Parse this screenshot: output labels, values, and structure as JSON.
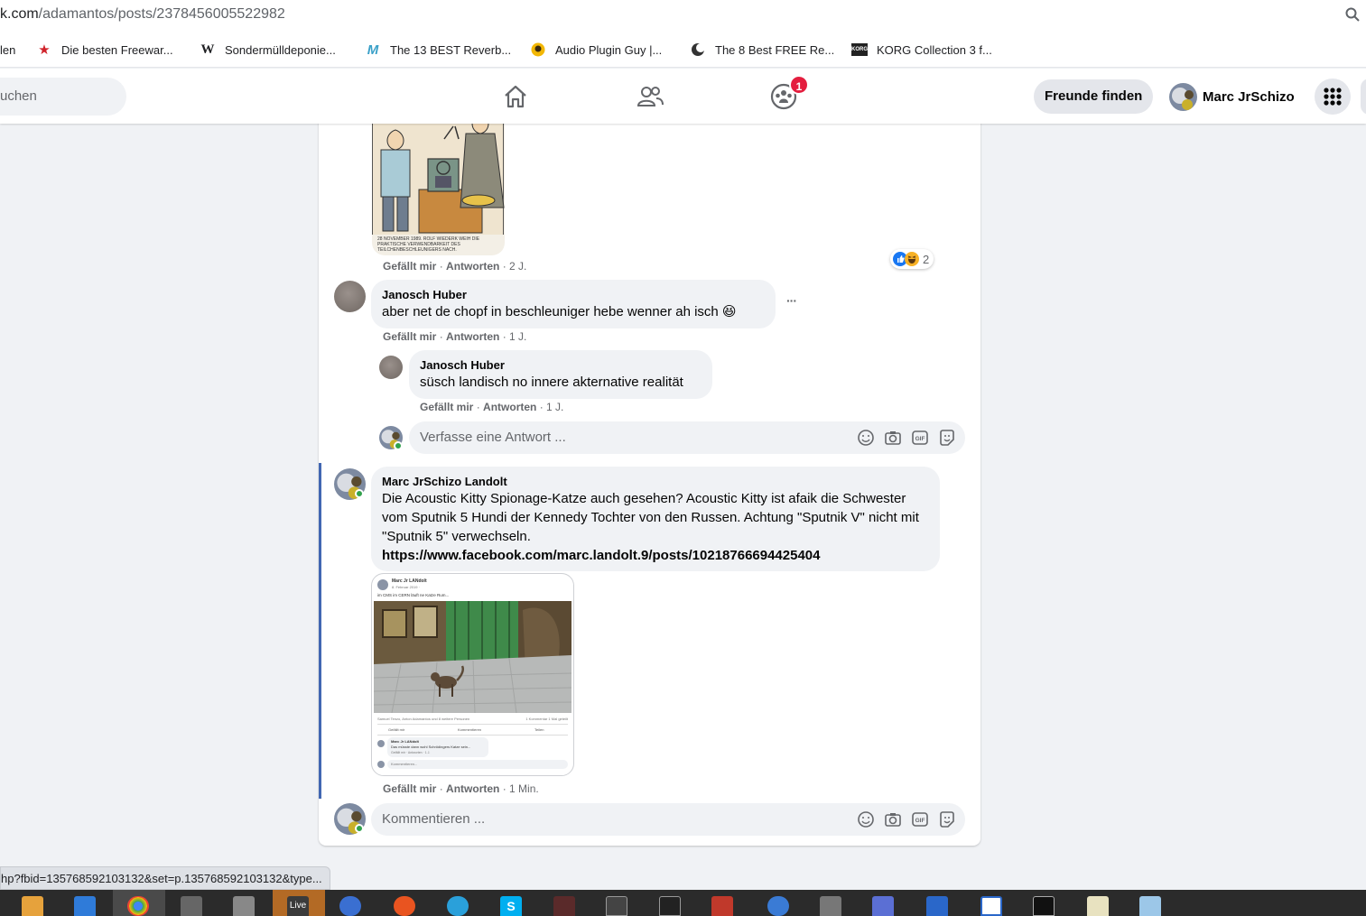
{
  "browser": {
    "url_prefix": "k.com",
    "url_path": "/adamantos/posts/2378456005522982",
    "status_url": "hp?fbid=135768592103132&set=p.135768592103132&type..."
  },
  "bookmarks": [
    {
      "label": "len",
      "icon": "folder-icon"
    },
    {
      "label": "Die besten Freewar...",
      "icon": "star-icon"
    },
    {
      "label": "Sondermülldeponie...",
      "icon": "wikipedia-icon",
      "glyph": "W"
    },
    {
      "label": "The 13 BEST Reverb...",
      "icon": "musician-icon"
    },
    {
      "label": "Audio Plugin Guy |...",
      "icon": "plugin-guy-icon"
    },
    {
      "label": "The 8 Best FREE Re...",
      "icon": "moon-icon"
    },
    {
      "label": "KORG Collection 3 f...",
      "icon": "korg-icon",
      "glyph": "KORG"
    }
  ],
  "header": {
    "search_placeholder": "uchen",
    "groups_badge": "1",
    "find_friends": "Freunde finden",
    "profile_name": "Marc JrSchizo"
  },
  "comments": {
    "first": {
      "like": "Gefällt mir",
      "reply": "Antworten",
      "time": "2 J.",
      "reaction_count": "2",
      "caption": "28 NOVEMBER 1989. ROLF WIEDERK WEIH DIE PRAKTISCHE VERWENDBARKEIT DES TEILCHENBESCHLEUNIGERS NACH."
    },
    "janosch1": {
      "name": "Janosch Huber",
      "text": "aber net de chopf in beschleuniger hebe wenner ah isch 😆",
      "like": "Gefällt mir",
      "reply": "Antworten",
      "time": "1 J.",
      "more": "···"
    },
    "janosch2": {
      "name": "Janosch Huber",
      "text": "süsch landisch no innere akternative realität",
      "like": "Gefällt mir",
      "reply": "Antworten",
      "time": "1 J."
    },
    "reply_placeholder": "Verfasse eine Antwort ...",
    "marc": {
      "name": "Marc JrSchizo Landolt",
      "text": "Die Acoustic Kitty Spionage-Katze auch gesehen? Acoustic Kitty ist afaik die Schwester vom Sputnik 5 Hundi der Kennedy Tochter von den Russen. Achtung \"Sputnik V\" nicht mit \"Sputnik 5\" verwechseln.",
      "link": "https://www.facebook.com/marc.landolt.9/posts/10218766694425404",
      "like": "Gefällt mir",
      "reply": "Antworten",
      "time": "1 Min."
    },
    "comment_placeholder": "Kommentieren ..."
  },
  "screenshot_thumb": {
    "author": "Marc Jr LANdolt",
    "date": "8. Februar 2019 ·",
    "caption": "im CMS im CERN läuft ne Katze Rum...",
    "reactions": "Samuel Tenzo, Anton Adamantos und 8 weitere Personen",
    "counts": "1 Kommentar 1 Mal geteilt",
    "btn_like": "Gefällt mir",
    "btn_comment": "Kommentieren",
    "btn_share": "Teilen",
    "c_name": "Marc Jr LANdolt",
    "c_text": "Das müsste dann wohl Schrödingers Katze sein...",
    "c_actions": "Gefällt mir · Antworten · 1 J.",
    "c_input": "Kommentieren..."
  },
  "colors": {
    "fb_blue": "#1877f2",
    "badge_red": "#e41e3f",
    "bubble": "#f0f2f5",
    "online": "#31a24c",
    "highlight_bar": "#4267b2"
  }
}
